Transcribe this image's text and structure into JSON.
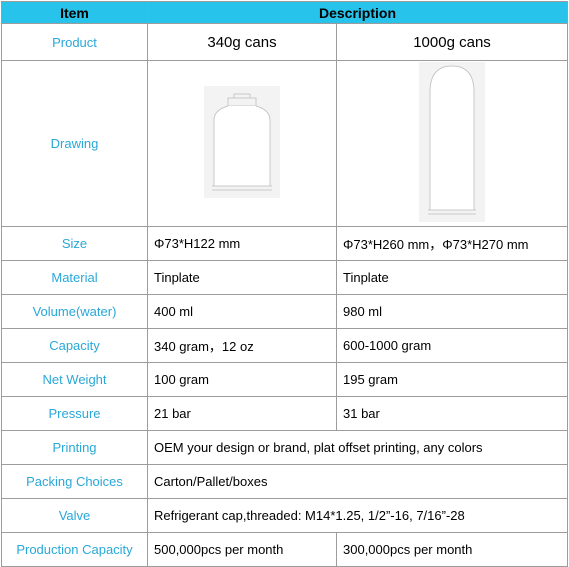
{
  "header": {
    "item": "Item",
    "description": "Description"
  },
  "product": {
    "label": "Product",
    "col1": "340g cans",
    "col2": "1000g cans"
  },
  "drawing": {
    "label": "Drawing",
    "col1_icon": "short-can-drawing-icon",
    "col2_icon": "tall-can-drawing-icon"
  },
  "rows": [
    {
      "label": "Size",
      "col1": "Φ73*H122 mm",
      "col2": "Φ73*H260 mm，Φ73*H270 mm"
    },
    {
      "label": "Material",
      "col1": "Tinplate",
      "col2": "Tinplate"
    },
    {
      "label": "Volume(water)",
      "col1": "400 ml",
      "col2": "980 ml"
    },
    {
      "label": "Capacity",
      "col1": "340 gram，12 oz",
      "col2": "600-1000 gram"
    },
    {
      "label": "Net Weight",
      "col1": "100 gram",
      "col2": "195 gram"
    },
    {
      "label": "Pressure",
      "col1": "21 bar",
      "col2": "31 bar"
    }
  ],
  "printing": {
    "label": "Printing",
    "value": "OEM your design or brand, plat offset printing, any colors"
  },
  "packing": {
    "label": "Packing Choices",
    "value": "Carton/Pallet/boxes"
  },
  "valve": {
    "label": "Valve",
    "value": "Refrigerant cap,threaded: M14*1.25, 1/2”-16, 7/16”-28"
  },
  "production": {
    "label": "Production Capacity",
    "col1": "500,000pcs per month",
    "col2": "300,000pcs per month"
  },
  "colors": {
    "header_bg": "#27c3ea",
    "label_text": "#28a8d8",
    "border": "#9c9c9c"
  }
}
